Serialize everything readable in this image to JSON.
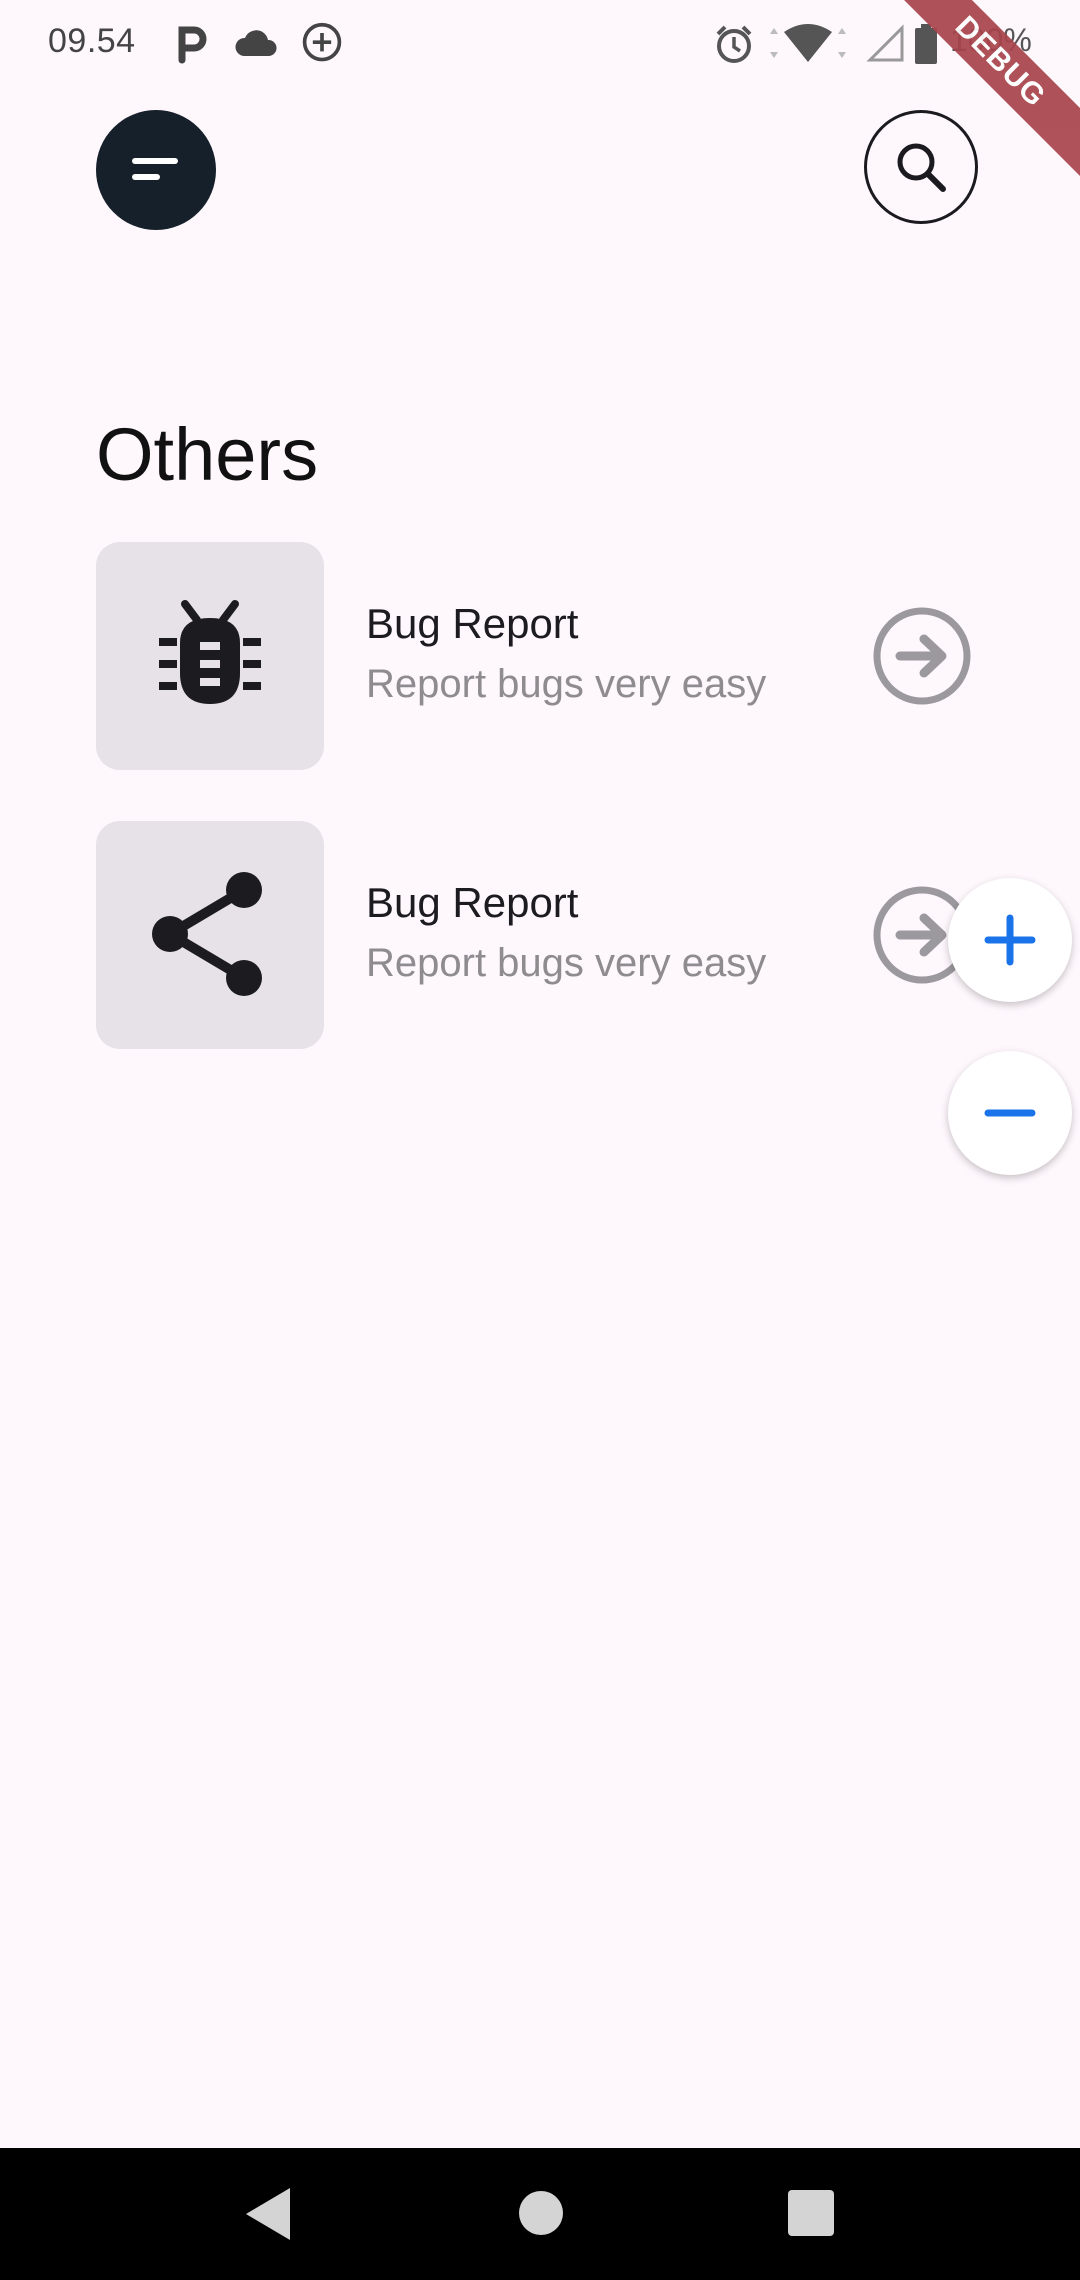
{
  "status_bar": {
    "time": "09.54",
    "battery": "100%",
    "icons": [
      "parking-icon",
      "cloud-icon",
      "add-circle-icon",
      "alarm-icon",
      "wifi-icon",
      "signal-icon",
      "battery-icon"
    ]
  },
  "debug_banner": "DEBUG",
  "header": {
    "menu_icon": "menu-icon",
    "search_icon": "search-icon"
  },
  "section": {
    "title": "Others"
  },
  "items": [
    {
      "title": "Bug Report",
      "subtitle": "Report bugs very easy",
      "icon": "bug-icon"
    },
    {
      "title": "Bug Report",
      "subtitle": "Report bugs very easy",
      "icon": "share-icon"
    }
  ],
  "fabs": {
    "zoom_in_icon": "plus-icon",
    "zoom_out_icon": "minus-icon"
  },
  "nav": {
    "icons": [
      "back-icon",
      "home-icon",
      "recents-icon"
    ]
  },
  "colors": {
    "background": "#fef7fc",
    "menu_button": "#15202b",
    "tile": "#e7e1e8",
    "accent": "#1a73e8",
    "debug": "#a8434b"
  }
}
